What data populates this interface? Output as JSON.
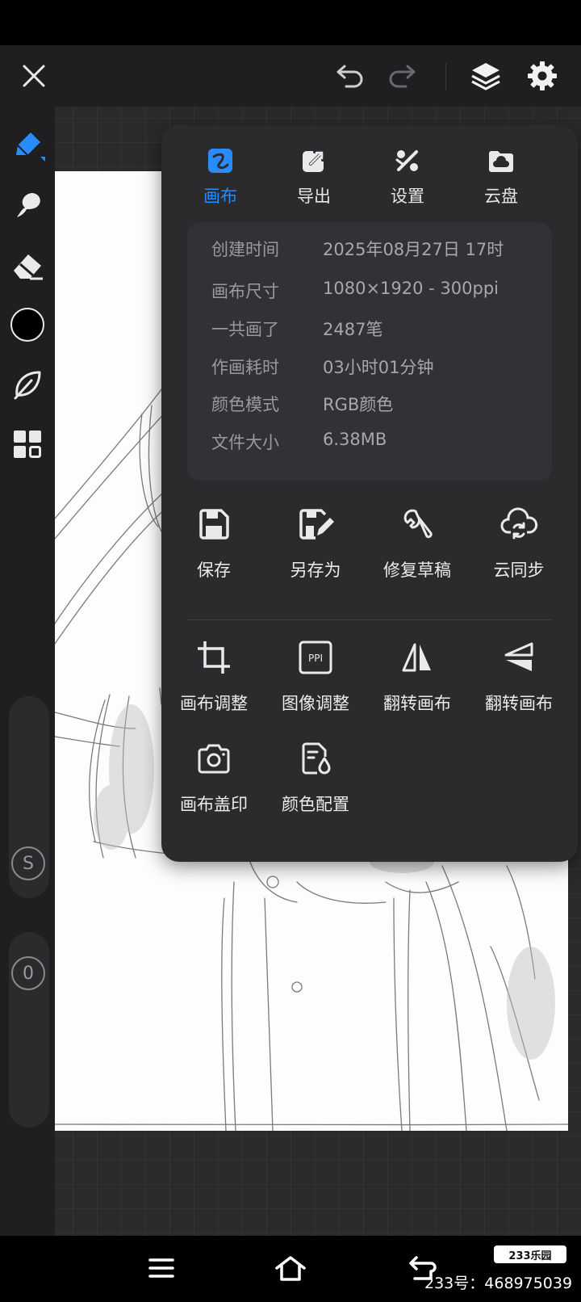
{
  "colors": {
    "accent": "#2a8bff",
    "panel_bg": "#2b2b2e",
    "toolbar_bg": "#1f1f21",
    "brush_color": "#000000"
  },
  "top_bar": {
    "icons": [
      "close-icon",
      "undo-icon",
      "redo-icon",
      "layers-icon",
      "gear-icon"
    ]
  },
  "left_toolbar": {
    "tools": [
      "pen-icon",
      "smudge-icon",
      "eraser-icon",
      "color-swatch",
      "leaf-icon",
      "grid-icon"
    ],
    "size_slider_label": "S",
    "opacity_slider_label": "0"
  },
  "panel": {
    "tabs": [
      {
        "label": "画布",
        "icon": "canvas-icon",
        "active": true
      },
      {
        "label": "导出",
        "icon": "export-icon",
        "active": false
      },
      {
        "label": "设置",
        "icon": "settings-icon",
        "active": false
      },
      {
        "label": "云盘",
        "icon": "cloud-drive-icon",
        "active": false
      }
    ],
    "info": [
      {
        "key": "创建时间",
        "value": "2025年08月27日 17时"
      },
      {
        "key": "画布尺寸",
        "value": "1080×1920 - 300ppi"
      },
      {
        "key": "一共画了",
        "value": "2487笔"
      },
      {
        "key": "作画耗时",
        "value": "03小时01分钟"
      },
      {
        "key": "颜色模式",
        "value": "RGB颜色"
      },
      {
        "key": "文件大小",
        "value": "6.38MB"
      }
    ],
    "actions_row1": [
      {
        "label": "保存",
        "icon": "save-icon"
      },
      {
        "label": "另存为",
        "icon": "save-as-icon"
      },
      {
        "label": "修复草稿",
        "icon": "wrench-icon"
      },
      {
        "label": "云同步",
        "icon": "cloud-sync-icon"
      }
    ],
    "actions_row2": [
      {
        "label": "画布调整",
        "icon": "crop-icon"
      },
      {
        "label": "图像调整",
        "icon": "ppi-icon"
      },
      {
        "label": "翻转画布",
        "icon": "flip-horizontal-icon"
      },
      {
        "label": "翻转画布",
        "icon": "flip-vertical-icon"
      }
    ],
    "actions_row3": [
      {
        "label": "画布盖印",
        "icon": "camera-icon"
      },
      {
        "label": "颜色配置",
        "icon": "color-profile-icon"
      }
    ]
  },
  "nav_bar": {
    "icons": [
      "menu-icon",
      "home-icon",
      "back-icon"
    ]
  },
  "watermark": {
    "logo": "233乐园",
    "text": "233号：468975039"
  }
}
